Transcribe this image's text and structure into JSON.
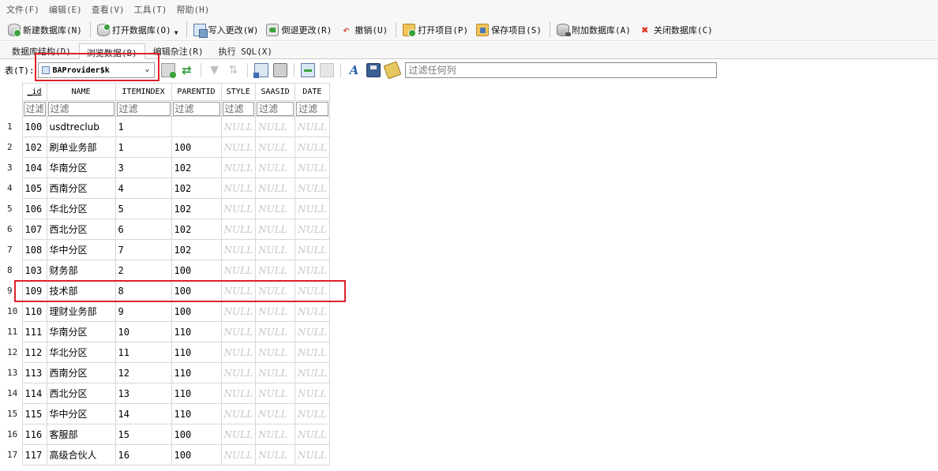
{
  "menu": [
    "文件(F)",
    "编辑(E)",
    "查看(V)",
    "工具(T)",
    "帮助(H)"
  ],
  "toolbar": {
    "new_db": "新建数据库(N)",
    "open_db": "打开数据库(O)",
    "write_changes": "写入更改(W)",
    "revert_changes": "倒退更改(R)",
    "undo": "撤销(U)",
    "open_project": "打开项目(P)",
    "save_project": "保存项目(S)",
    "attach_db": "附加数据库(A)",
    "close_db": "关闭数据库(C)"
  },
  "tabs": [
    {
      "label": "数据库结构(D)",
      "active": false
    },
    {
      "label": "浏览数据(B)",
      "active": true
    },
    {
      "label": "编辑杂注(R)",
      "active": false
    },
    {
      "label": "执行 SQL(X)",
      "active": false
    }
  ],
  "tablebar": {
    "label": "表(T):",
    "selected_table": "BAProvider$k",
    "filter_placeholder": "过滤任何列"
  },
  "grid": {
    "columns": [
      "_id",
      "NAME",
      "ITEMINDEX",
      "PARENTID",
      "STYLE",
      "SAASID",
      "DATE"
    ],
    "filter_placeholder": "过滤",
    "null_text": "NULL",
    "rows": [
      {
        "n": "1",
        "id": "100",
        "name": "usdtreclub",
        "itemindex": "1",
        "parentid": ""
      },
      {
        "n": "2",
        "id": "102",
        "name": "刷单业务部",
        "itemindex": "1",
        "parentid": "100"
      },
      {
        "n": "3",
        "id": "104",
        "name": "华南分区",
        "itemindex": "3",
        "parentid": "102"
      },
      {
        "n": "4",
        "id": "105",
        "name": "西南分区",
        "itemindex": "4",
        "parentid": "102"
      },
      {
        "n": "5",
        "id": "106",
        "name": "华北分区",
        "itemindex": "5",
        "parentid": "102"
      },
      {
        "n": "6",
        "id": "107",
        "name": "西北分区",
        "itemindex": "6",
        "parentid": "102"
      },
      {
        "n": "7",
        "id": "108",
        "name": "华中分区",
        "itemindex": "7",
        "parentid": "102"
      },
      {
        "n": "8",
        "id": "103",
        "name": "财务部",
        "itemindex": "2",
        "parentid": "100"
      },
      {
        "n": "9",
        "id": "109",
        "name": "技术部",
        "itemindex": "8",
        "parentid": "100"
      },
      {
        "n": "10",
        "id": "110",
        "name": "理财业务部",
        "itemindex": "9",
        "parentid": "100"
      },
      {
        "n": "11",
        "id": "111",
        "name": "华南分区",
        "itemindex": "10",
        "parentid": "110"
      },
      {
        "n": "12",
        "id": "112",
        "name": "华北分区",
        "itemindex": "11",
        "parentid": "110"
      },
      {
        "n": "13",
        "id": "113",
        "name": "西南分区",
        "itemindex": "12",
        "parentid": "110"
      },
      {
        "n": "14",
        "id": "114",
        "name": "西北分区",
        "itemindex": "13",
        "parentid": "110"
      },
      {
        "n": "15",
        "id": "115",
        "name": "华中分区",
        "itemindex": "14",
        "parentid": "110"
      },
      {
        "n": "16",
        "id": "116",
        "name": "客服部",
        "itemindex": "15",
        "parentid": "100"
      },
      {
        "n": "17",
        "id": "117",
        "name": "高级合伙人",
        "itemindex": "16",
        "parentid": "100"
      }
    ]
  },
  "colors": {
    "highlight": "#e0202a"
  }
}
